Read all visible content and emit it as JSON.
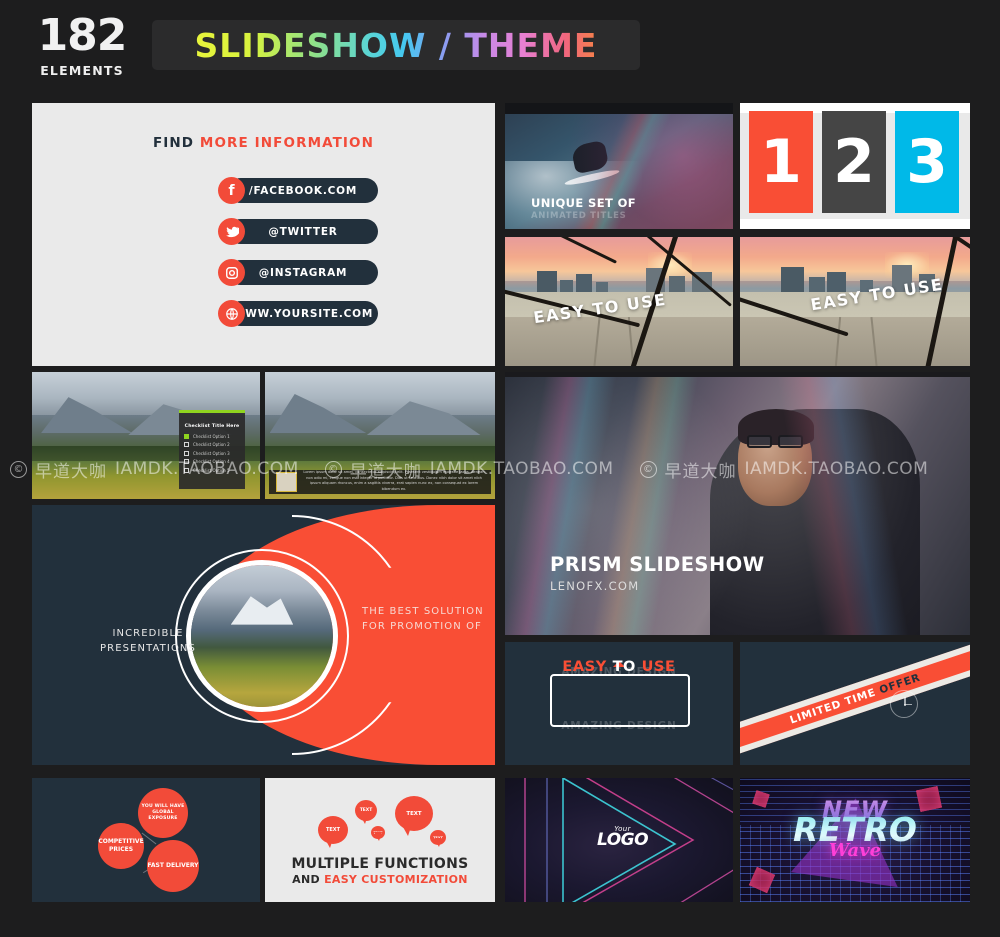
{
  "header": {
    "count_number": "182",
    "count_label": "ELEMENTS",
    "title": "SLIDESHOW  /  THEME",
    "title_gradient": "#e8f53c → #45c8f0 → #f5804a",
    "plate_color": "#2b2b2c"
  },
  "background_color": "#1d1d1e",
  "accent_colors": {
    "red": "#f94e35",
    "navy": "#22303c",
    "cyan": "#00b9e8",
    "green": "#8fd41f",
    "light_gray": "#eaeaea",
    "dark_gray": "#454545",
    "magenta": "#ff3fd8"
  },
  "tiles": {
    "social": {
      "heading_plain": "FIND ",
      "heading_accent": "MORE INFORMATION",
      "rows": [
        {
          "icon": "facebook-icon",
          "label": "/FACEBOOK.COM"
        },
        {
          "icon": "twitter-icon",
          "label": "@TWITTER"
        },
        {
          "icon": "instagram-icon",
          "label": "@INSTAGRAM"
        },
        {
          "icon": "globe-icon",
          "label": "WWW.YOURSITE.COM"
        }
      ]
    },
    "surf": {
      "caption_main": "UNIQUE SET OF",
      "caption_sub": "ANIMATED TITLES"
    },
    "numbers": {
      "items": [
        {
          "value": "1",
          "color": "#f94e35"
        },
        {
          "value": "2",
          "color": "#454545"
        },
        {
          "value": "3",
          "color": "#00b9e8"
        }
      ]
    },
    "city_left": {
      "text": "EASY TO USE"
    },
    "city_right": {
      "text": "EASY TO USE"
    },
    "checklist": {
      "title": "Checklist Title Here",
      "items": [
        {
          "label": "Checklist Option 1",
          "checked": true
        },
        {
          "label": "Checklist Option 2",
          "checked": false
        },
        {
          "label": "Checklist Option 3",
          "checked": false
        },
        {
          "label": "Checklist Option 4",
          "checked": false
        },
        {
          "label": "Checklist Option 5",
          "checked": false
        }
      ]
    },
    "lower_third": {
      "body": "Lorem ipsum dolor sit amet, consectetur adipiscing elit. Praesent vestibulum molestie lacus. Aenean non odio mi, congue non est. Integer id porttitor. Duis ut faucibus. Donec nibh dolor sit amet nibh ipsum aliquam rhoncus, enim a sagittis viverra, erat sapien nunc ex, non consequat ex lorem bibendum ex."
    },
    "prism": {
      "title": "PRISM SLIDESHOW",
      "subtitle": "LENOFX.COM"
    },
    "incredible": {
      "left_text": "INCREDIBLE PRESENTATIONS",
      "right_text": "THE BEST SOLUTION FOR PROMOTION OF"
    },
    "easy_box": {
      "ghost_top": "AMAZING DESIGN",
      "ghost_bottom": "AMAZING DESIGN",
      "word1": "EASY",
      "word2": "TO",
      "word3": "USE"
    },
    "offer": {
      "text_light": "LIMITED TIME ",
      "text_dark": "OFFER",
      "icon": "clock-icon"
    },
    "circles": {
      "bubbles": [
        "YOU WILL HAVE GLOBAL EXPOSURE",
        "COMPETITIVE PRICES",
        "FAST DELIVERY"
      ]
    },
    "multi": {
      "bubble_label": "TEXT",
      "bubble_count": 5,
      "title": "MULTIPLE FUNCTIONS",
      "sub_plain": "AND ",
      "sub_accent": "EASY CUSTOMIZATION"
    },
    "neon": {
      "logo_line1": "Your",
      "logo_line2": "LOGO"
    },
    "retro": {
      "line1": "NEW",
      "line2": "RETRO",
      "line3": "Wave"
    }
  },
  "watermark": {
    "copyright": "©",
    "chinese": "早道大咖",
    "english": "IAMDK.TAOBAO.COM"
  }
}
